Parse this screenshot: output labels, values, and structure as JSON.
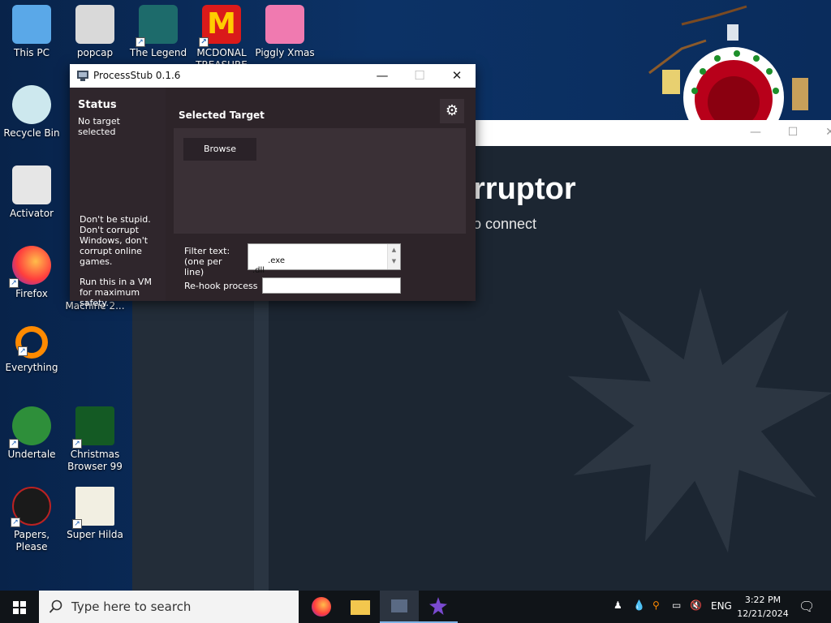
{
  "desktop": {
    "icons": [
      {
        "label": "This PC",
        "icon": "this-pc-icon"
      },
      {
        "label": "popcap",
        "icon": "folder-icon"
      },
      {
        "label": "The Legend",
        "icon": "legend-game-icon"
      },
      {
        "label": "MCDONAL TREASURE",
        "icon": "mcdonalds-icon"
      },
      {
        "label": "Piggly Xmas",
        "icon": "piggly-icon"
      },
      {
        "label": "Recycle Bin",
        "icon": "recycle-bin-icon"
      },
      {
        "label": "Activator",
        "icon": "activator-icon"
      },
      {
        "label": "Firefox",
        "icon": "firefox-icon"
      },
      {
        "label": "Machine 2...",
        "icon": "machine-icon"
      },
      {
        "label": "Everything",
        "icon": "everything-icon"
      },
      {
        "label": "Undertale",
        "icon": "undertale-icon"
      },
      {
        "label": "Christmas Browser 99",
        "icon": "christmas-browser-icon"
      },
      {
        "label": "Papers, Please",
        "icon": "papers-please-icon"
      },
      {
        "label": "Super Hilda",
        "icon": "super-hilda-icon"
      }
    ]
  },
  "corruptor": {
    "heading": "rruptor",
    "subtext": "o connect"
  },
  "processstub": {
    "title": "ProcessStub 0.1.6",
    "status_title": "Status",
    "status_text": "No target selected",
    "warning": "Don't be stupid. Don't corrupt Windows, don't corrupt online games.",
    "vm_tip": "Run this in a VM for maximum safety.",
    "selected_target_label": "Selected Target",
    "browse_label": "Browse",
    "filter_label": "Filter text: (one per line)",
    "filter_value": ".exe\n.dll",
    "rehook_label": "Re-hook process",
    "rehook_value": ""
  },
  "taskbar": {
    "search_placeholder": "Type here to search",
    "language": "ENG",
    "time": "3:22 PM",
    "date": "12/21/2024"
  }
}
